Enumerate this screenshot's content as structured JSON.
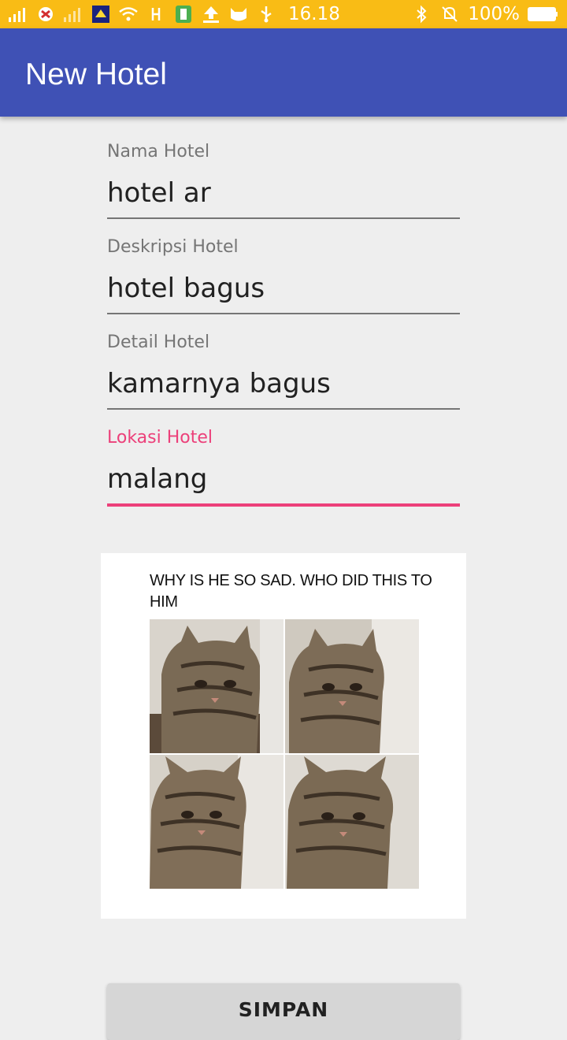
{
  "status_bar": {
    "time": "16.18",
    "battery_percent": "100%",
    "background_color": "#f9bc15",
    "left_icons": [
      "signal-icon",
      "app-notification-icon",
      "signal-icon",
      "app-notification-icon",
      "wifi-icon",
      "usb-debug-icon",
      "battery-saver-icon",
      "upload-icon",
      "cat-app-icon",
      "usb-icon"
    ],
    "right_icons": [
      "bluetooth-icon",
      "notifications-off-icon",
      "battery-icon"
    ]
  },
  "app_bar": {
    "title": "New Hotel",
    "background_color": "#3f51b5"
  },
  "form": {
    "nama_hotel": {
      "label": "Nama Hotel",
      "value": "hotel ar"
    },
    "deskripsi_hotel": {
      "label": "Deskripsi Hotel",
      "value": "hotel bagus"
    },
    "detail_hotel": {
      "label": "Detail Hotel",
      "value": "kamarnya bagus"
    },
    "lokasi_hotel": {
      "label": "Lokasi Hotel",
      "value": "malang",
      "focused": true
    },
    "accent_color": "#ec407a"
  },
  "image": {
    "caption": "WHY IS HE SO SAD. WHO DID THIS TO HIM"
  },
  "save_button": {
    "label": "SIMPAN"
  }
}
